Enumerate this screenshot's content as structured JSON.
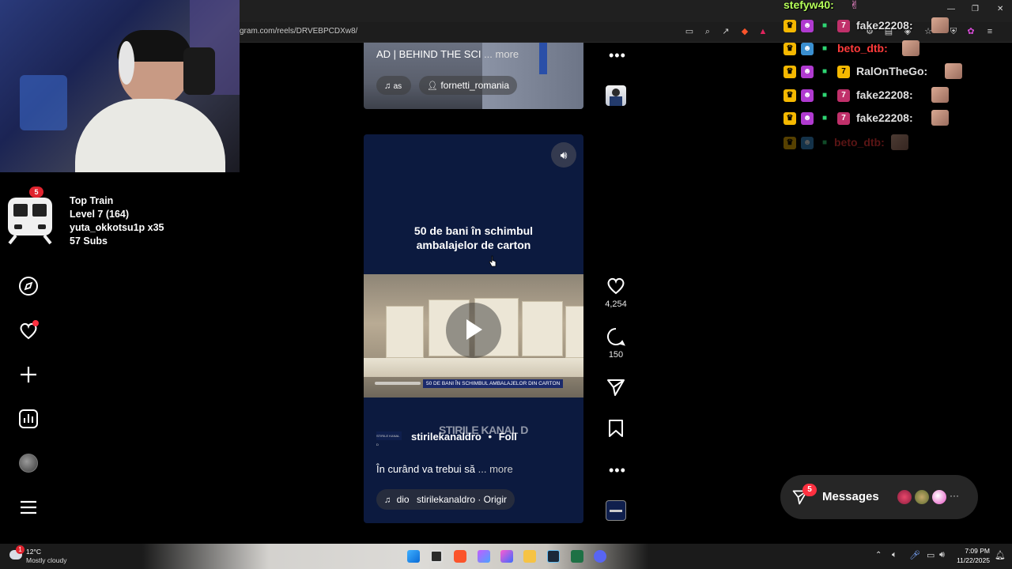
{
  "browser": {
    "url": "gram.com/reels/DRVEBPCDXw8/"
  },
  "stream_overlay": {
    "train_badge": "5",
    "train_title": "Top Train",
    "train_level": "Level 7  (164)",
    "train_user": "yuta_okkotsu1p x35",
    "train_subs": "57 Subs"
  },
  "reel_top": {
    "caption": "AD | BEHIND THE SCI",
    "more": "... more",
    "audio": "as",
    "account": "fornetti_romania"
  },
  "reel_main": {
    "headline_line1": "50 de bani în schimbul",
    "headline_line2": "ambalajelor de carton",
    "banner": "50 DE BANI ÎN SCHIMBUL AMBALAJELOR DIN CARTON",
    "watermark": "STIRILE KANAL D",
    "username": "stirilekanaldro",
    "separator": "•",
    "follow": "Foll",
    "caption": "În curând va trebui să",
    "more": "... more",
    "audio_prefix": "dio",
    "audio": "stirilekanaldro · Origir",
    "channel_logo": "STIRILE KANAL D"
  },
  "actions": {
    "likes": "4,254",
    "comments": "150"
  },
  "chat": [
    {
      "name": "stefyw40:",
      "color": "#b6ff5a"
    },
    {
      "name": "fake22208:",
      "color": "#e0e0e0"
    },
    {
      "name": "beto_dtb:",
      "color": "#ff3b3b"
    },
    {
      "name": "RalOnTheGo:",
      "color": "#e0e0e0"
    },
    {
      "name": "fake22208:",
      "color": "#e0e0e0"
    },
    {
      "name": "fake22208:",
      "color": "#e0e0e0"
    },
    {
      "name": "beto_dtb:",
      "color": "#ff3b3b"
    }
  ],
  "messages": {
    "label": "Messages",
    "badge": "5",
    "more": "···"
  },
  "taskbar": {
    "weather_badge": "1",
    "temperature": "12°C",
    "condition": "Mostly cloudy",
    "time": "7:09 PM",
    "date": "11/22/2025"
  }
}
